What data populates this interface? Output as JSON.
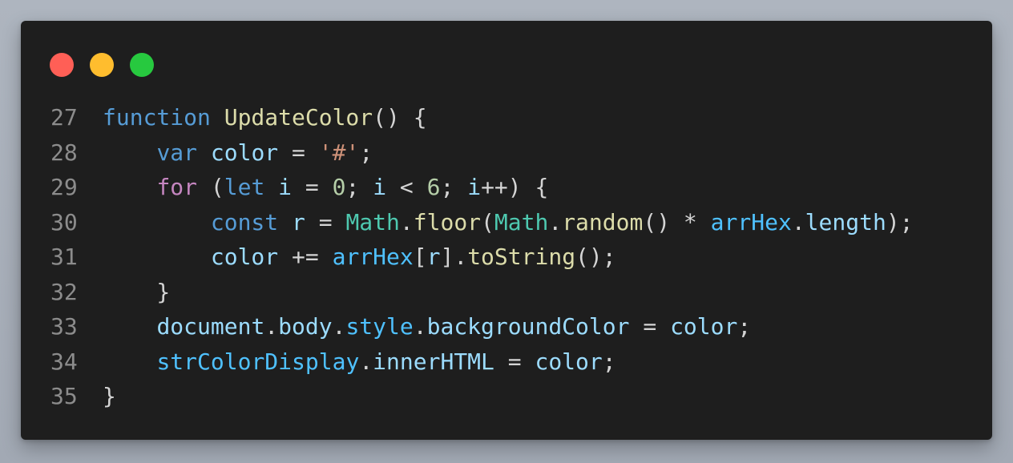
{
  "window": {
    "controls": [
      {
        "name": "close-button",
        "color": "#ff5f56"
      },
      {
        "name": "minimize-button",
        "color": "#ffbd2e"
      },
      {
        "name": "maximize-button",
        "color": "#27c93f"
      }
    ]
  },
  "code": {
    "lines": [
      {
        "number": "27",
        "tokens": [
          {
            "t": "function",
            "c": "kw"
          },
          {
            "t": " ",
            "c": "pun"
          },
          {
            "t": "UpdateColor",
            "c": "fn"
          },
          {
            "t": "() {",
            "c": "pun"
          }
        ]
      },
      {
        "number": "28",
        "tokens": [
          {
            "t": "    ",
            "c": "pun"
          },
          {
            "t": "var",
            "c": "kw"
          },
          {
            "t": " ",
            "c": "pun"
          },
          {
            "t": "color",
            "c": "var"
          },
          {
            "t": " = ",
            "c": "pun"
          },
          {
            "t": "'#'",
            "c": "str"
          },
          {
            "t": ";",
            "c": "pun"
          }
        ]
      },
      {
        "number": "29",
        "tokens": [
          {
            "t": "    ",
            "c": "pun"
          },
          {
            "t": "for",
            "c": "ctl"
          },
          {
            "t": " (",
            "c": "pun"
          },
          {
            "t": "let",
            "c": "kw"
          },
          {
            "t": " ",
            "c": "pun"
          },
          {
            "t": "i",
            "c": "var"
          },
          {
            "t": " = ",
            "c": "pun"
          },
          {
            "t": "0",
            "c": "num"
          },
          {
            "t": "; ",
            "c": "pun"
          },
          {
            "t": "i",
            "c": "var"
          },
          {
            "t": " < ",
            "c": "pun"
          },
          {
            "t": "6",
            "c": "num"
          },
          {
            "t": "; ",
            "c": "pun"
          },
          {
            "t": "i",
            "c": "var"
          },
          {
            "t": "++) {",
            "c": "pun"
          }
        ]
      },
      {
        "number": "30",
        "tokens": [
          {
            "t": "        ",
            "c": "pun"
          },
          {
            "t": "const",
            "c": "kw"
          },
          {
            "t": " ",
            "c": "pun"
          },
          {
            "t": "r",
            "c": "var"
          },
          {
            "t": " = ",
            "c": "pun"
          },
          {
            "t": "Math",
            "c": "cls"
          },
          {
            "t": ".",
            "c": "pun"
          },
          {
            "t": "floor",
            "c": "fn"
          },
          {
            "t": "(",
            "c": "pun"
          },
          {
            "t": "Math",
            "c": "cls"
          },
          {
            "t": ".",
            "c": "pun"
          },
          {
            "t": "random",
            "c": "fn"
          },
          {
            "t": "() * ",
            "c": "pun"
          },
          {
            "t": "arrHex",
            "c": "glob"
          },
          {
            "t": ".",
            "c": "pun"
          },
          {
            "t": "length",
            "c": "var"
          },
          {
            "t": ");",
            "c": "pun"
          }
        ]
      },
      {
        "number": "31",
        "tokens": [
          {
            "t": "        ",
            "c": "pun"
          },
          {
            "t": "color",
            "c": "var"
          },
          {
            "t": " += ",
            "c": "pun"
          },
          {
            "t": "arrHex",
            "c": "glob"
          },
          {
            "t": "[",
            "c": "pun"
          },
          {
            "t": "r",
            "c": "var"
          },
          {
            "t": "].",
            "c": "pun"
          },
          {
            "t": "toString",
            "c": "fn"
          },
          {
            "t": "();",
            "c": "pun"
          }
        ]
      },
      {
        "number": "32",
        "tokens": [
          {
            "t": "    }",
            "c": "pun"
          }
        ]
      },
      {
        "number": "33",
        "tokens": [
          {
            "t": "    ",
            "c": "pun"
          },
          {
            "t": "document",
            "c": "var"
          },
          {
            "t": ".",
            "c": "pun"
          },
          {
            "t": "body",
            "c": "var"
          },
          {
            "t": ".",
            "c": "pun"
          },
          {
            "t": "style",
            "c": "glob"
          },
          {
            "t": ".",
            "c": "pun"
          },
          {
            "t": "backgroundColor",
            "c": "var"
          },
          {
            "t": " = ",
            "c": "pun"
          },
          {
            "t": "color",
            "c": "var"
          },
          {
            "t": ";",
            "c": "pun"
          }
        ]
      },
      {
        "number": "34",
        "tokens": [
          {
            "t": "    ",
            "c": "pun"
          },
          {
            "t": "strColorDisplay",
            "c": "glob"
          },
          {
            "t": ".",
            "c": "pun"
          },
          {
            "t": "innerHTML",
            "c": "var"
          },
          {
            "t": " = ",
            "c": "pun"
          },
          {
            "t": "color",
            "c": "var"
          },
          {
            "t": ";",
            "c": "pun"
          }
        ]
      },
      {
        "number": "35",
        "tokens": [
          {
            "t": "}",
            "c": "pun"
          }
        ]
      }
    ]
  }
}
